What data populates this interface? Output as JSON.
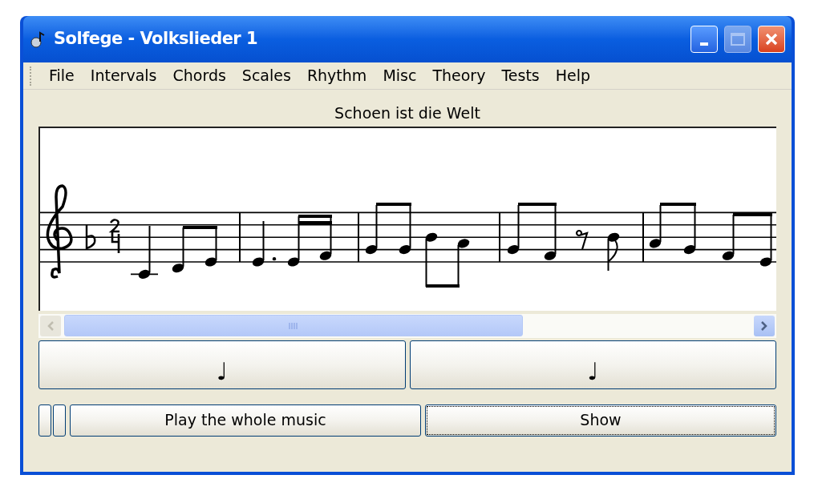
{
  "window": {
    "title": "Solfege - Volkslieder 1",
    "maximize_enabled": false
  },
  "menu": [
    {
      "label": "File"
    },
    {
      "label": "Intervals"
    },
    {
      "label": "Chords"
    },
    {
      "label": "Scales"
    },
    {
      "label": "Rhythm"
    },
    {
      "label": "Misc"
    },
    {
      "label": "Theory"
    },
    {
      "label": "Tests"
    },
    {
      "label": "Help"
    }
  ],
  "song_title": "Schoen ist die Welt",
  "note_buttons": [
    {
      "label": "♩"
    },
    {
      "label": "♩"
    }
  ],
  "actions": [
    {
      "label": "Play the whole music",
      "focused": false
    },
    {
      "label": "Show",
      "focused": true
    }
  ]
}
